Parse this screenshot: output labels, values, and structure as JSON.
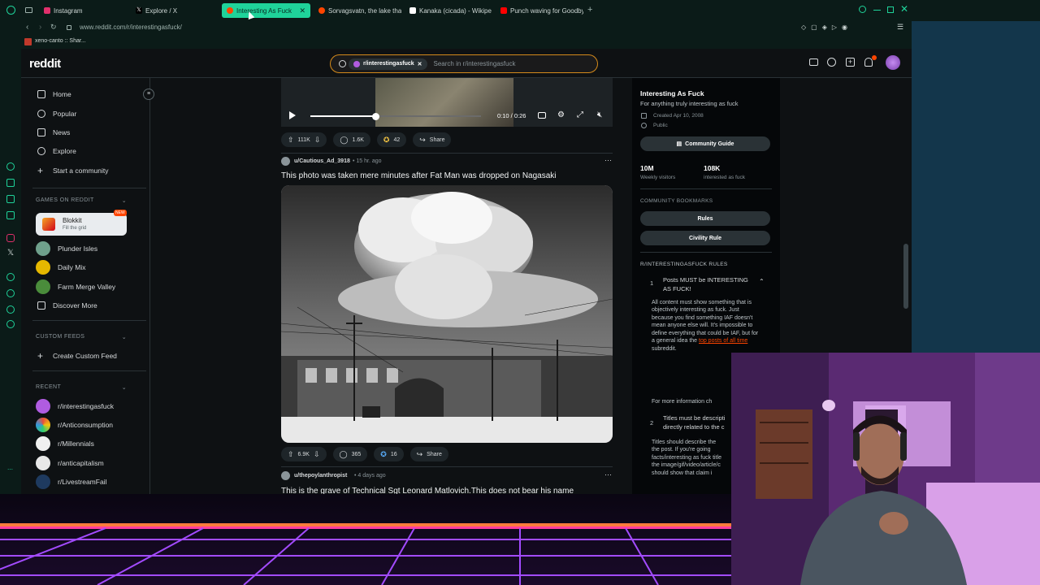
{
  "tabs": [
    {
      "label": "Instagram",
      "color": "#e1306c"
    },
    {
      "label": "Explore / X",
      "color": "#000000"
    },
    {
      "label": "Interesting As Fuck",
      "color": "#ff4500",
      "active": true
    },
    {
      "label": "Sorvagsvatn, the lake that",
      "color": "#ff4500"
    },
    {
      "label": "Kanaka (cicada) - Wikipe",
      "color": "#ffffff"
    },
    {
      "label": "Punch waving for Goodby",
      "color": "#ff0000"
    }
  ],
  "url": "www.reddit.com/r/interestingasfuck/",
  "bookmark": "xeno-canto :: Shar...",
  "reddit": {
    "logo": "reddit",
    "search_chip": "r/interestingasfuck",
    "search_placeholder": "Search in r/interestingasfuck",
    "nav": [
      "Home",
      "Popular",
      "News",
      "Explore",
      "Start a community"
    ],
    "games_heading": "GAMES ON REDDIT",
    "featured_game": {
      "name": "Blokkit",
      "sub": "Fill the grid",
      "badge": "NEW"
    },
    "games": [
      "Plunder Isles",
      "Daily Mix",
      "Farm Merge Valley",
      "Discover More"
    ],
    "custom_heading": "CUSTOM FEEDS",
    "create_feed": "Create Custom Feed",
    "recent_heading": "RECENT",
    "recent": [
      "r/interestingasfuck",
      "r/Anticonsumption",
      "r/Millennials",
      "r/anticapitalism",
      "r/LivestreamFail"
    ]
  },
  "video": {
    "time": "0:10 / 0:26",
    "progress": 0.38
  },
  "post_prev_actions": {
    "votes": "111K",
    "comments": "1.6K",
    "awards": "42",
    "share": "Share"
  },
  "post1": {
    "user": "u/Cautious_Ad_3918",
    "age": "• 15 hr. ago",
    "title": "This photo was taken mere minutes after Fat Man was dropped on Nagasaki",
    "votes": "6.9K",
    "comments": "365",
    "awards": "16",
    "share": "Share"
  },
  "post2": {
    "user": "u/thepoylanthropist",
    "age": "• 4 days ago",
    "title": "This is the grave of Technical Sgt Leonard Matlovich.This does not bear his name"
  },
  "community": {
    "name": "Interesting As Fuck",
    "desc": "For anything truly interesting as fuck",
    "created": "Created Apr 10, 2008",
    "visibility": "Public",
    "guide_btn": "Community Guide",
    "visitors": "10M",
    "visitors_label": "Weekly visitors",
    "members": "108K",
    "members_label": "interested as fuck",
    "bookmarks_heading": "COMMUNITY BOOKMARKS",
    "bookmark1": "Rules",
    "bookmark2": "Civility Rule",
    "rules_heading": "R/INTERESTINGASFUCK RULES",
    "rule1_num": "1",
    "rule1": "Posts MUST be INTERESTING AS FUCK!",
    "rule1_body": "All content must show something that is objectively interesting as fuck. Just because you find something IAF doesn't mean anyone else will. It's impossible to define everything that could be IAF, but for a general idea the",
    "rule1_link": "top posts of all time",
    "rule1_tail": "subreddit.",
    "rule1_more": "For more information ch",
    "rule2_num": "2",
    "rule2": "Titles must be descripti directly related to the c",
    "rule2_body": "Titles should describe the the post. If you're going facts/interesting as fuck title the image/gif/video/article/c should show that claim i"
  }
}
